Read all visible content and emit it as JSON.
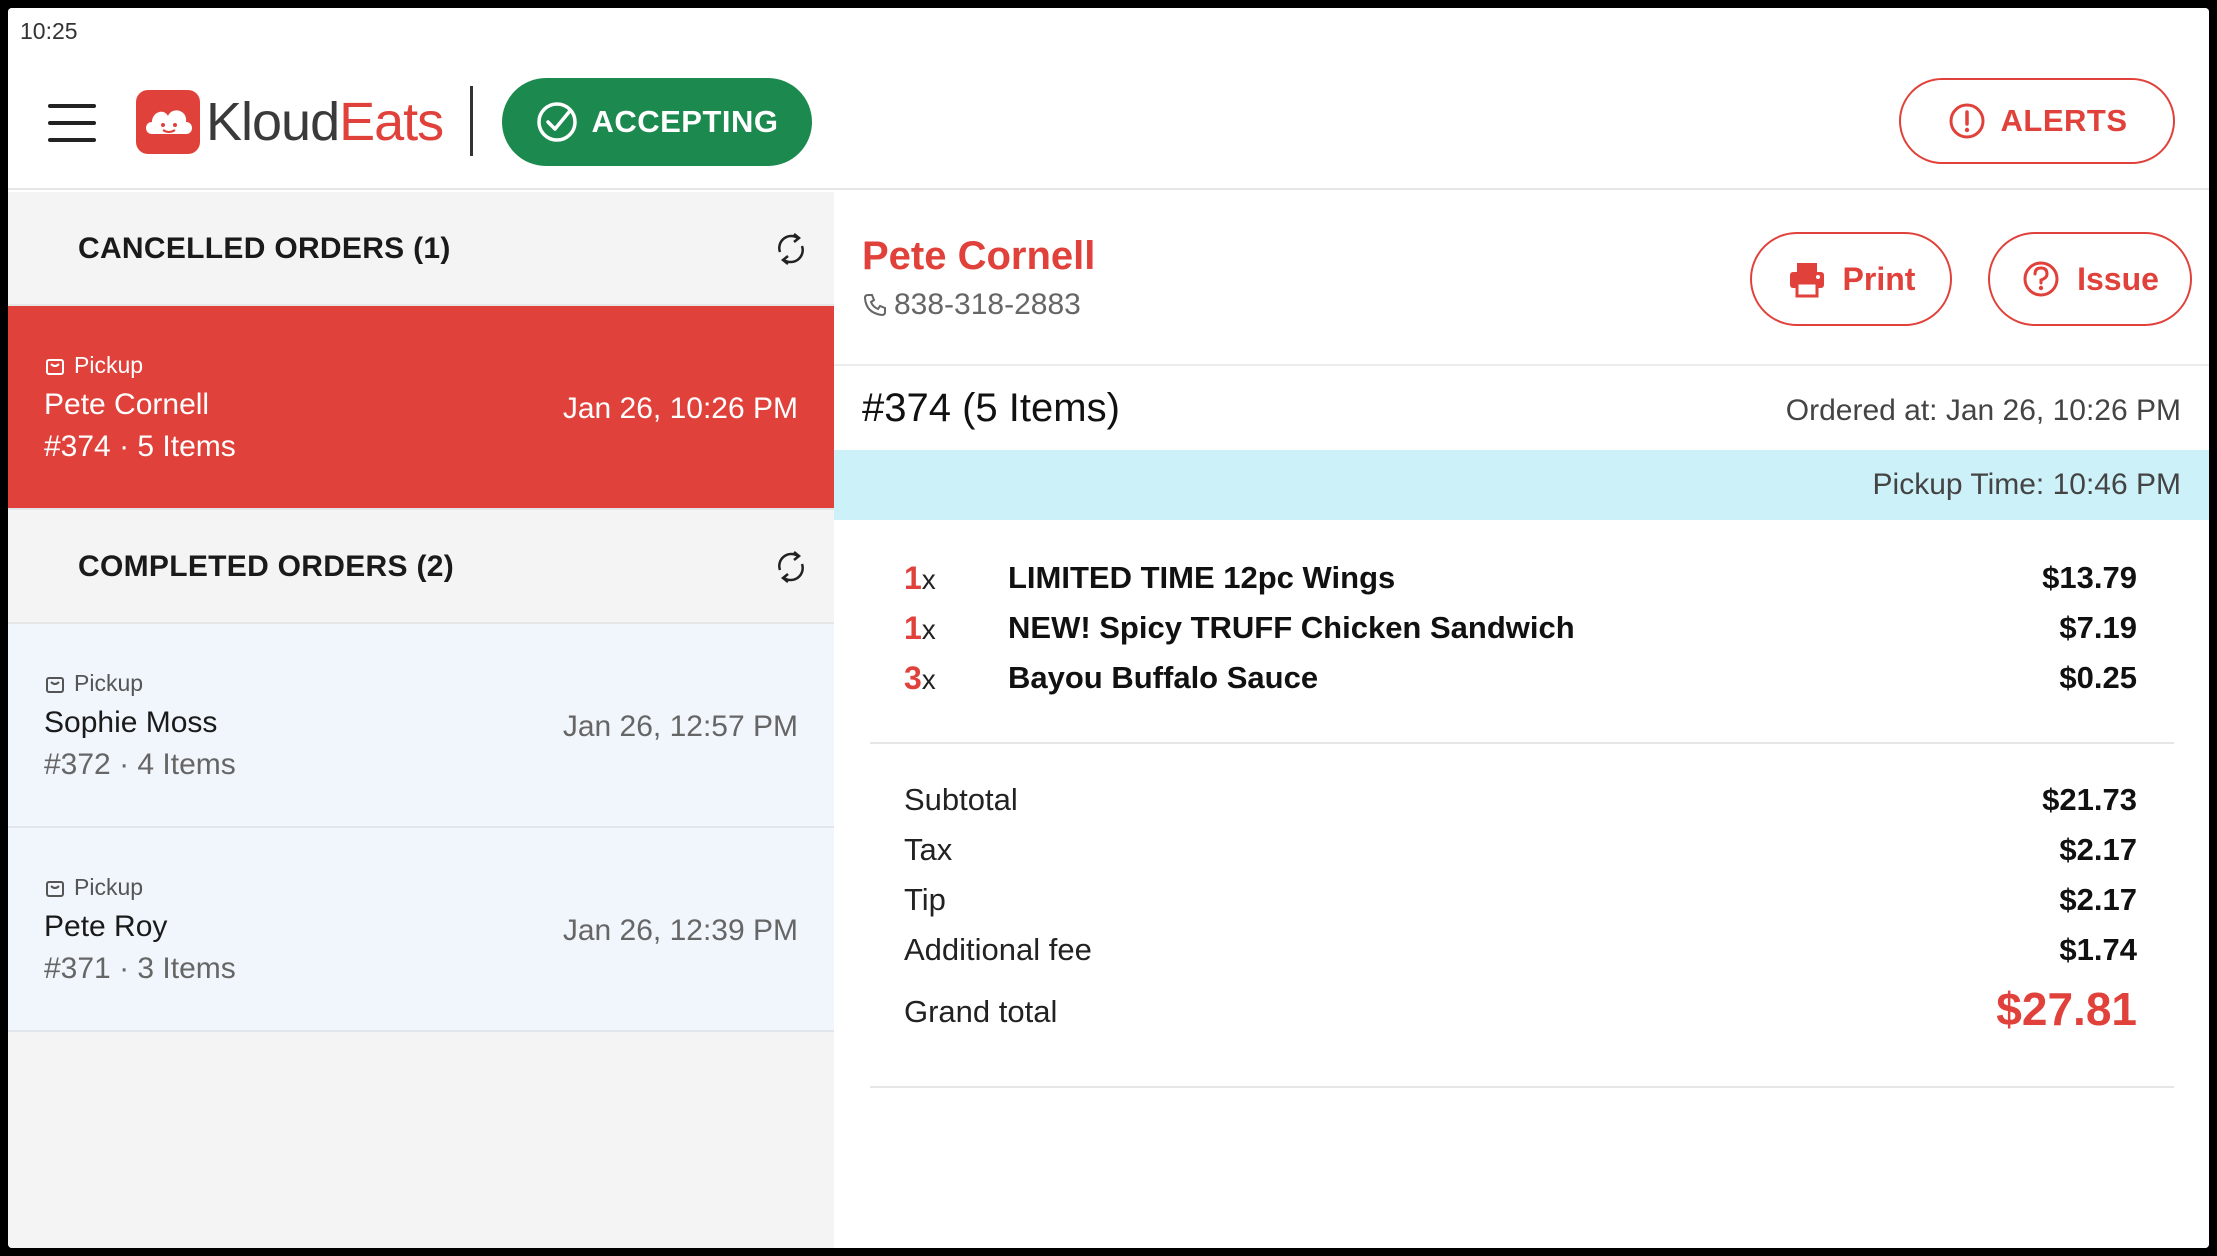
{
  "status_bar": {
    "time": "10:25"
  },
  "header": {
    "logo_text_k": "Kloud",
    "logo_text_eats": "Eats",
    "accepting_label": "ACCEPTING",
    "alerts_label": "ALERTS"
  },
  "sections": {
    "cancelled_title": "CANCELLED ORDERS (1)",
    "completed_title": "COMPLETED ORDERS (2)"
  },
  "cancelled_orders": [
    {
      "type": "Pickup",
      "name": "Pete Cornell",
      "meta": "#374 · 5 Items",
      "date": "Jan 26, 10:26 PM"
    }
  ],
  "completed_orders": [
    {
      "type": "Pickup",
      "name": "Sophie Moss",
      "meta": "#372 · 4 Items",
      "date": "Jan 26, 12:57 PM"
    },
    {
      "type": "Pickup",
      "name": "Pete Roy",
      "meta": "#371 · 3 Items",
      "date": "Jan 26, 12:39 PM"
    }
  ],
  "detail": {
    "customer_name": "Pete Cornell",
    "phone": "838-318-2883",
    "print_label": "Print",
    "issue_label": "Issue",
    "order_number": "#374 (5 Items)",
    "ordered_at": "Ordered at: Jan 26, 10:26 PM",
    "pickup_time": "Pickup Time: 10:46 PM",
    "items": [
      {
        "qty": "1",
        "x": "x",
        "name": "LIMITED TIME 12pc Wings",
        "price": "$13.79"
      },
      {
        "qty": "1",
        "x": "x",
        "name": "NEW! Spicy TRUFF Chicken Sandwich",
        "price": "$7.19"
      },
      {
        "qty": "3",
        "x": "x",
        "name": "Bayou Buffalo Sauce",
        "price": "$0.25"
      }
    ],
    "totals": {
      "subtotal_label": "Subtotal",
      "subtotal": "$21.73",
      "tax_label": "Tax",
      "tax": "$2.17",
      "tip_label": "Tip",
      "tip": "$2.17",
      "fee_label": "Additional fee",
      "fee": "$1.74",
      "grand_label": "Grand total",
      "grand": "$27.81"
    }
  },
  "colors": {
    "brand_red": "#e0413a",
    "accepting_green": "#1c8a4e",
    "pickup_bar": "#cdf1f8"
  },
  "icons": [
    "menu-icon",
    "logo-cloud-icon",
    "check-circle-icon",
    "alert-circle-icon",
    "refresh-icon",
    "bag-icon",
    "phone-icon",
    "printer-icon",
    "help-circle-icon"
  ]
}
